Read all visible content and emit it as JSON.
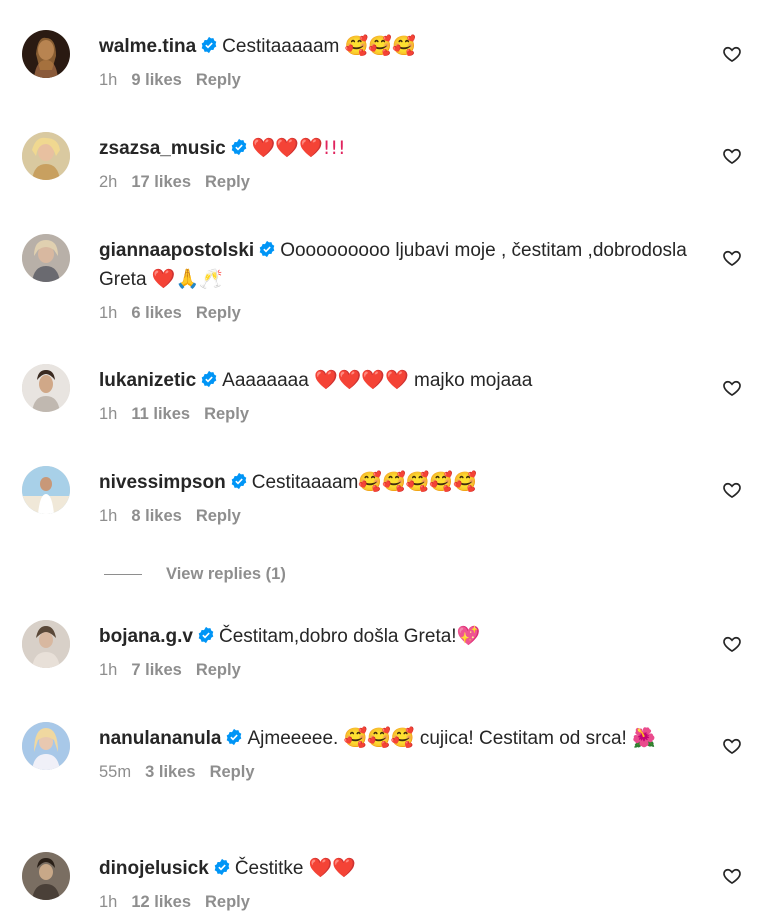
{
  "comments": [
    {
      "username": "walme.tina",
      "text": "Cestitaaaaam",
      "emojis": "🥰🥰🥰",
      "time": "1h",
      "likes": "9 likes",
      "reply": "Reply"
    },
    {
      "username": "zsazsa_music",
      "text": "",
      "emojis": "❤️❤️❤️!!!",
      "time": "2h",
      "likes": "17 likes",
      "reply": "Reply"
    },
    {
      "username": "giannaapostolski",
      "text": "Oooooooooo ljubavi moje , čestitam ,dobrodosla Greta",
      "emojis": "❤️🙏🥂",
      "time": "1h",
      "likes": "6 likes",
      "reply": "Reply"
    },
    {
      "username": "lukanizetic",
      "text": "Aaaaaaaa",
      "emojis": "❤️❤️❤️❤️",
      "text2": "majko mojaaa",
      "time": "1h",
      "likes": "11 likes",
      "reply": "Reply"
    },
    {
      "username": "nivessimpson",
      "text": "Cestitaaaam",
      "emojis": "🥰🥰🥰🥰🥰",
      "time": "1h",
      "likes": "8 likes",
      "reply": "Reply"
    },
    {
      "username": "bojana.g.v",
      "text": "Čestitam,dobro došla Greta!",
      "emojis": "💖",
      "time": "1h",
      "likes": "7 likes",
      "reply": "Reply"
    },
    {
      "username": "nanulananula",
      "text": "Ajmeeeee.",
      "emojis": "🥰🥰🥰",
      "text2": "cujica! Cestitam od srca!",
      "emojis2": "🌺",
      "time": "55m",
      "likes": "3 likes",
      "reply": "Reply"
    },
    {
      "username": "dinojelusick",
      "text": "Čestitke",
      "emojis": "❤️❤️",
      "time": "1h",
      "likes": "12 likes",
      "reply": "Reply"
    }
  ],
  "view_replies": "View replies (1)",
  "colors": {
    "text": "#262626",
    "muted": "#8e8e8e",
    "verified": "#0095f6"
  },
  "icons": {
    "verified": "verified-badge-icon",
    "like": "heart-outline-icon"
  }
}
